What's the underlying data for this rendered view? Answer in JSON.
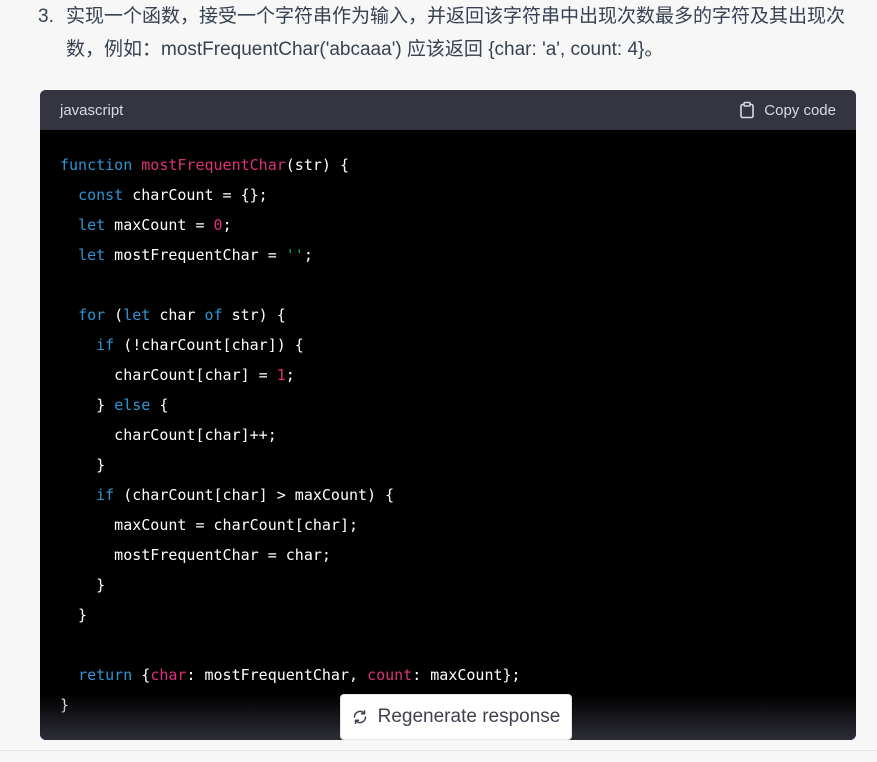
{
  "list_item": {
    "number": "3.",
    "text": "实现一个函数，接受一个字符串作为输入，并返回该字符串中出现次数最多的字符及其出现次数，例如：mostFrequentChar('abcaaa') 应该返回 {char: 'a', count: 4}。"
  },
  "code_block": {
    "language": "javascript",
    "copy_label": "Copy code",
    "lines": [
      "function mostFrequentChar(str) {",
      "  const charCount = {};",
      "  let maxCount = 0;",
      "  let mostFrequentChar = '';",
      "",
      "  for (let char of str) {",
      "    if (!charCount[char]) {",
      "      charCount[char] = 1;",
      "    } else {",
      "      charCount[char]++;",
      "    }",
      "    if (charCount[char] > maxCount) {",
      "      maxCount = charCount[char];",
      "      mostFrequentChar = char;",
      "    }",
      "  }",
      "",
      "  return {char: mostFrequentChar, count: maxCount};",
      "}"
    ]
  },
  "regenerate_label": "Regenerate response",
  "colors": {
    "keyword": "#2e95d3",
    "function_name": "#df3079",
    "string": "#00a67d",
    "number": "#df3079",
    "code_background": "#000000",
    "header_background": "#343541"
  },
  "icons": {
    "copy": "clipboard-icon",
    "regenerate": "refresh-icon"
  }
}
